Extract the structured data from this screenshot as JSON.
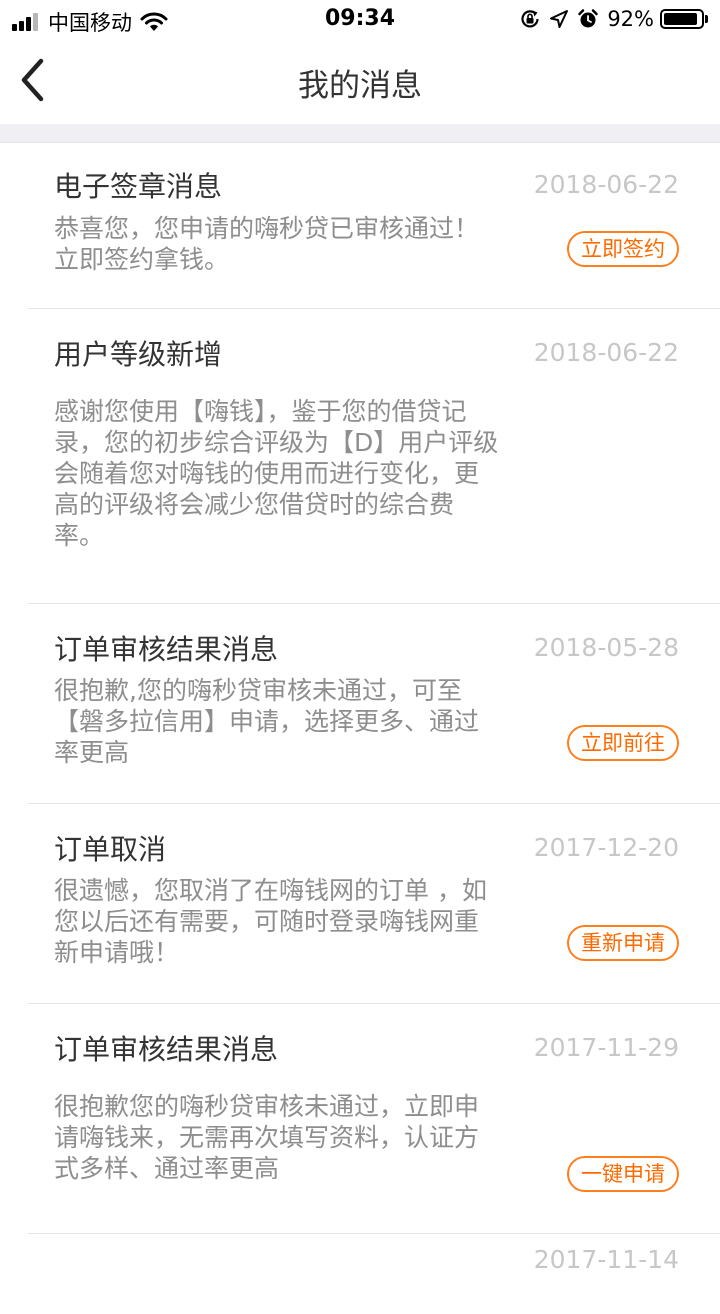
{
  "status_bar": {
    "carrier": "中国移动",
    "time": "09:34",
    "battery": "92%",
    "battery_level": 0.92,
    "icons": [
      "signal-icon",
      "wifi-icon",
      "orientation-lock-icon",
      "location-icon",
      "alarm-icon",
      "battery-icon"
    ]
  },
  "nav": {
    "back_icon": "chevron-left-icon",
    "title": "我的消息"
  },
  "colors": {
    "accent": "#ff7f1e",
    "title_text": "#333333",
    "body_text": "#8e8e8e",
    "date_text": "#c7c7c7",
    "divider": "#e5e5e5",
    "gap_bg": "#efeff4"
  },
  "messages": [
    {
      "title": "电子签章消息",
      "date": "2018-06-22",
      "body_lines": [
        "恭喜您，您申请的嗨秒贷已审核通过！",
        "立即签约拿钱。"
      ],
      "action": "立即签约"
    },
    {
      "title": "用户等级新增",
      "date": "2018-06-22",
      "body_lines": [
        "感谢您使用【嗨钱】，鉴于您的借贷记",
        "录，您的初步综合评级为【D】用户评级",
        "会随着您对嗨钱的使用而进行变化，更",
        "高的评级将会减少您借贷时的综合费",
        "率。"
      ]
    },
    {
      "title": "订单审核结果消息",
      "date": "2018-05-28",
      "body_lines": [
        "很抱歉,您的嗨秒贷审核未通过，可至",
        "【磐多拉信用】申请，选择更多、通过",
        "率更高"
      ],
      "action": "立即前往"
    },
    {
      "title": "订单取消",
      "date": "2017-12-20",
      "body_lines": [
        "很遗憾，您取消了在嗨钱网的订单 ，如",
        "您以后还有需要，可随时登录嗨钱网重",
        "新申请哦！"
      ],
      "action": "重新申请"
    },
    {
      "title": "订单审核结果消息",
      "date": "2017-11-29",
      "body_lines": [
        "很抱歉您的嗨秒贷审核未通过，立即申",
        "请嗨钱来，无需再次填写资料，认证方",
        "式多样、通过率更高"
      ],
      "action": "一键申请"
    },
    {
      "title": "",
      "date": "2017-11-14"
    }
  ]
}
